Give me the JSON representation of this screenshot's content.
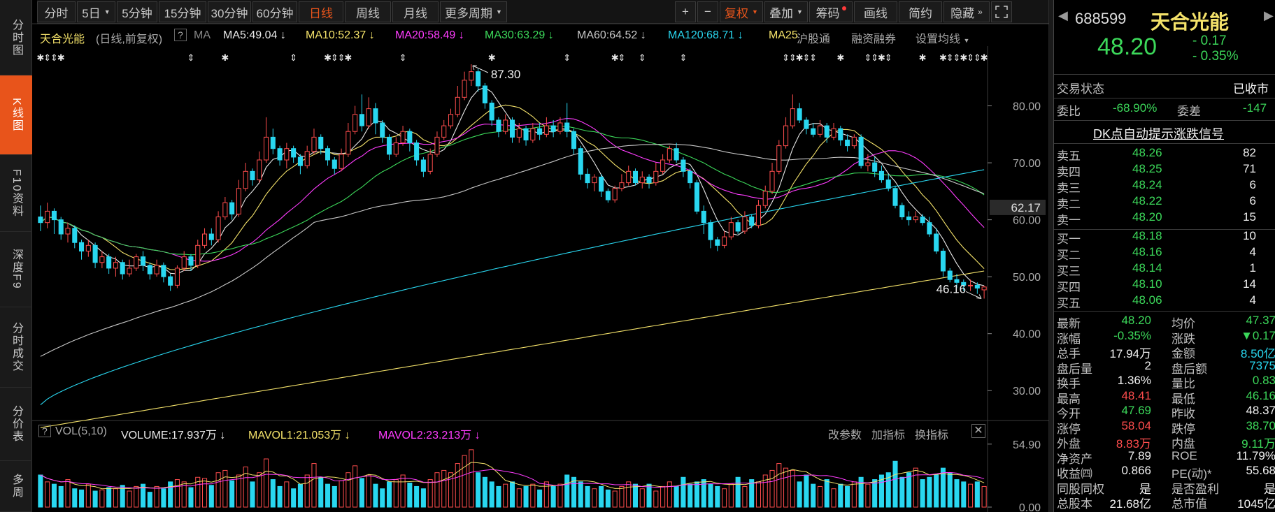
{
  "left_nav": [
    {
      "label": "分时图",
      "active": false
    },
    {
      "label": "K线图",
      "active": true
    },
    {
      "label": "F10资料",
      "active": false
    },
    {
      "label": "深度F9",
      "active": false
    },
    {
      "label": "分时成交",
      "active": false
    },
    {
      "label": "分价表",
      "active": false
    },
    {
      "label": "多周",
      "active": false
    }
  ],
  "toolbar": {
    "periods": [
      "分时",
      "5日",
      "5分钟",
      "15分钟",
      "30分钟",
      "60分钟",
      "日线",
      "周线",
      "月线",
      "更多周期"
    ],
    "active_period": "日线",
    "plus": "+",
    "minus": "−",
    "fuquan": "复权",
    "diejia": "叠加",
    "chouma": "筹码",
    "huaxian": "画线",
    "jianyue": "简约",
    "yincang": "隐藏",
    "fullscreen_icon": "expand-icon"
  },
  "ma_legend": {
    "stock": "天合光能",
    "mode": "(日线,前复权)",
    "help": "?",
    "ma": "MA",
    "ma5": "MA5:49.04",
    "ma10": "MA10:52.37",
    "ma20": "MA20:58.49",
    "ma30": "MA30:63.29",
    "ma60": "MA60:64.52",
    "ma120": "MA120:68.71",
    "ma250": "MA25",
    "hgt": "沪股通",
    "rzrq": "融资融券",
    "settings": "设置均线"
  },
  "colors": {
    "up": "#ff4d4d",
    "down": "#29d7f0",
    "ma5": "#e8e8e8",
    "ma10": "#f4e26a",
    "ma20": "#ff3cff",
    "ma30": "#3cd85a",
    "ma60": "#c8c8c8",
    "ma120": "#29d7f0",
    "ma250": "#f4e26a"
  },
  "volume_legend": {
    "help": "?",
    "vol": "VOL(5,10)",
    "volume": "VOLUME:17.937万",
    "mavol1": "MAVOL1:21.053万",
    "mavol2": "MAVOL2:23.213万",
    "gaicanshu": "改参数",
    "jiazhibiao": "加指标",
    "huanzhibiao": "换指标"
  },
  "chart_data": {
    "type": "candlestick",
    "title": "天合光能 (日线,前复权)",
    "price_axis": {
      "ticks": [
        "80.00",
        "70.00",
        "60.00",
        "50.00",
        "40.00",
        "30.00"
      ],
      "range": [
        25,
        90
      ]
    },
    "current_price_marker": "62.17",
    "high_label": "87.30",
    "low_label": "46.16",
    "volume_axis": {
      "ticks": [
        "54.90",
        "0.00"
      ],
      "range": [
        0,
        56
      ]
    },
    "candles": [
      [
        60.5,
        59.5,
        62.5,
        58.0
      ],
      [
        59.5,
        61.5,
        63.0,
        58.5
      ],
      [
        61.5,
        60.0,
        62.0,
        57.5
      ],
      [
        60.0,
        57.5,
        60.5,
        56.5
      ],
      [
        57.5,
        58.5,
        59.5,
        56.0
      ],
      [
        58.5,
        56.0,
        59.0,
        55.0
      ],
      [
        56.0,
        54.5,
        56.5,
        53.0
      ],
      [
        54.5,
        55.5,
        56.5,
        53.5
      ],
      [
        55.5,
        52.5,
        56.0,
        51.5
      ],
      [
        52.5,
        53.5,
        54.5,
        51.5
      ],
      [
        53.5,
        51.5,
        54.0,
        50.5
      ],
      [
        51.5,
        52.5,
        53.5,
        50.0
      ],
      [
        52.5,
        50.5,
        53.0,
        49.5
      ],
      [
        50.5,
        51.5,
        53.0,
        50.0
      ],
      [
        51.5,
        53.5,
        54.0,
        51.0
      ],
      [
        53.5,
        52.0,
        54.5,
        51.0
      ],
      [
        52.0,
        50.5,
        52.5,
        49.5
      ],
      [
        50.5,
        52.0,
        53.0,
        50.0
      ],
      [
        52.0,
        50.0,
        52.5,
        49.0
      ],
      [
        50.0,
        48.5,
        50.5,
        47.5
      ],
      [
        48.5,
        51.5,
        52.0,
        48.0
      ],
      [
        51.5,
        53.5,
        54.5,
        51.0
      ],
      [
        53.5,
        52.0,
        54.0,
        51.0
      ],
      [
        52.0,
        55.5,
        56.5,
        51.5
      ],
      [
        55.5,
        57.5,
        58.5,
        55.0
      ],
      [
        57.5,
        56.5,
        58.5,
        55.5
      ],
      [
        56.5,
        60.5,
        61.5,
        56.0
      ],
      [
        60.5,
        63.0,
        64.0,
        60.0
      ],
      [
        63.0,
        61.0,
        63.5,
        60.0
      ],
      [
        61.0,
        65.5,
        67.0,
        60.5
      ],
      [
        65.5,
        68.5,
        70.0,
        65.0
      ],
      [
        68.5,
        67.0,
        69.0,
        66.0
      ],
      [
        67.0,
        70.5,
        72.0,
        66.5
      ],
      [
        70.5,
        74.5,
        78.0,
        70.0
      ],
      [
        74.5,
        72.5,
        76.0,
        71.5
      ],
      [
        72.5,
        70.5,
        73.0,
        69.5
      ],
      [
        70.5,
        72.5,
        73.5,
        69.0
      ],
      [
        72.5,
        71.0,
        73.0,
        70.0
      ],
      [
        71.0,
        69.5,
        71.5,
        68.0
      ],
      [
        69.5,
        72.0,
        73.0,
        69.0
      ],
      [
        72.0,
        74.5,
        76.0,
        71.5
      ],
      [
        74.5,
        72.5,
        75.0,
        71.5
      ],
      [
        72.5,
        70.5,
        73.0,
        69.5
      ],
      [
        70.5,
        69.0,
        71.0,
        68.0
      ],
      [
        69.0,
        71.5,
        72.5,
        68.5
      ],
      [
        71.5,
        75.5,
        77.0,
        71.0
      ],
      [
        75.5,
        78.5,
        80.0,
        75.0
      ],
      [
        78.5,
        76.5,
        82.0,
        75.5
      ],
      [
        76.5,
        79.5,
        81.5,
        76.0
      ],
      [
        79.5,
        77.0,
        80.5,
        75.0
      ],
      [
        77.0,
        74.5,
        77.5,
        73.5
      ],
      [
        74.5,
        71.5,
        75.0,
        70.5
      ],
      [
        71.5,
        73.5,
        74.5,
        71.0
      ],
      [
        73.5,
        75.5,
        76.5,
        73.0
      ],
      [
        75.5,
        73.5,
        76.0,
        72.0
      ],
      [
        73.5,
        70.5,
        74.0,
        69.5
      ],
      [
        70.5,
        68.5,
        71.0,
        67.5
      ],
      [
        68.5,
        71.5,
        72.5,
        68.0
      ],
      [
        71.5,
        74.5,
        75.5,
        71.0
      ],
      [
        74.5,
        76.5,
        77.5,
        74.0
      ],
      [
        76.5,
        78.5,
        79.5,
        76.0
      ],
      [
        78.5,
        81.5,
        83.5,
        78.0
      ],
      [
        81.5,
        84.5,
        86.0,
        81.0
      ],
      [
        84.5,
        86.0,
        87.3,
        83.5
      ],
      [
        86.0,
        83.5,
        86.5,
        82.5
      ],
      [
        83.5,
        80.5,
        84.0,
        79.5
      ],
      [
        80.5,
        77.5,
        81.0,
        76.5
      ],
      [
        77.5,
        75.5,
        78.0,
        74.5
      ],
      [
        75.5,
        77.5,
        78.5,
        75.0
      ],
      [
        77.5,
        74.5,
        78.0,
        73.5
      ],
      [
        74.5,
        76.0,
        77.0,
        73.5
      ],
      [
        76.0,
        74.0,
        76.5,
        73.0
      ],
      [
        74.0,
        76.0,
        77.0,
        73.5
      ],
      [
        76.0,
        75.0,
        77.0,
        74.0
      ],
      [
        75.0,
        76.5,
        78.0,
        74.5
      ],
      [
        76.5,
        75.5,
        77.5,
        74.5
      ],
      [
        75.5,
        77.0,
        78.0,
        75.0
      ],
      [
        77.0,
        75.5,
        80.5,
        74.5
      ],
      [
        75.5,
        72.5,
        76.0,
        71.5
      ],
      [
        72.5,
        68.0,
        73.0,
        67.0
      ],
      [
        68.0,
        66.5,
        69.0,
        65.5
      ],
      [
        66.5,
        67.5,
        68.0,
        65.0
      ],
      [
        67.5,
        65.0,
        68.0,
        64.0
      ],
      [
        65.0,
        63.5,
        65.5,
        63.0
      ],
      [
        63.5,
        65.5,
        66.0,
        63.0
      ],
      [
        65.5,
        66.5,
        68.0,
        65.0
      ],
      [
        66.5,
        68.5,
        69.5,
        66.0
      ],
      [
        68.5,
        66.5,
        69.0,
        66.0
      ],
      [
        66.5,
        67.5,
        68.5,
        65.5
      ],
      [
        67.5,
        66.5,
        68.0,
        65.5
      ],
      [
        66.5,
        68.5,
        70.0,
        66.0
      ],
      [
        68.5,
        70.5,
        71.5,
        68.0
      ],
      [
        70.5,
        72.5,
        73.0,
        70.0
      ],
      [
        72.5,
        70.5,
        73.5,
        70.0
      ],
      [
        70.5,
        68.5,
        71.0,
        67.5
      ],
      [
        68.5,
        66.5,
        69.0,
        65.5
      ],
      [
        66.5,
        61.5,
        67.0,
        61.0
      ],
      [
        61.5,
        59.5,
        62.5,
        57.5
      ],
      [
        59.5,
        56.5,
        60.0,
        55.0
      ],
      [
        56.5,
        55.5,
        57.0,
        54.5
      ],
      [
        55.5,
        57.0,
        58.0,
        55.0
      ],
      [
        57.0,
        59.5,
        60.5,
        56.5
      ],
      [
        59.5,
        58.0,
        60.0,
        57.5
      ],
      [
        58.0,
        60.5,
        61.5,
        57.5
      ],
      [
        60.5,
        59.0,
        61.0,
        58.5
      ],
      [
        59.0,
        62.5,
        63.5,
        58.5
      ],
      [
        62.5,
        65.0,
        66.0,
        62.0
      ],
      [
        65.0,
        68.5,
        70.0,
        64.5
      ],
      [
        68.5,
        73.0,
        74.0,
        68.0
      ],
      [
        73.0,
        76.5,
        78.0,
        72.5
      ],
      [
        76.5,
        79.5,
        82.0,
        76.0
      ],
      [
        79.5,
        77.5,
        80.5,
        77.0
      ],
      [
        77.5,
        76.0,
        78.0,
        75.0
      ],
      [
        76.0,
        75.0,
        77.0,
        74.5
      ],
      [
        75.0,
        76.5,
        77.5,
        74.5
      ],
      [
        76.5,
        74.5,
        77.0,
        73.5
      ],
      [
        74.5,
        76.0,
        77.0,
        74.0
      ],
      [
        76.0,
        74.0,
        76.5,
        73.0
      ],
      [
        74.0,
        73.0,
        75.0,
        72.0
      ],
      [
        73.0,
        74.5,
        75.0,
        72.5
      ],
      [
        74.5,
        69.5,
        75.0,
        69.0
      ],
      [
        69.5,
        70.0,
        71.5,
        68.5
      ],
      [
        70.0,
        68.5,
        71.0,
        67.5
      ],
      [
        68.5,
        67.0,
        69.5,
        66.5
      ],
      [
        67.0,
        65.5,
        68.0,
        65.0
      ],
      [
        65.5,
        62.5,
        66.0,
        62.0
      ],
      [
        62.5,
        60.5,
        63.0,
        60.0
      ],
      [
        60.5,
        60.0,
        61.5,
        59.0
      ],
      [
        60.0,
        60.5,
        61.5,
        59.5
      ],
      [
        60.5,
        59.5,
        61.0,
        59.0
      ],
      [
        59.5,
        57.5,
        60.5,
        57.0
      ],
      [
        57.5,
        54.5,
        58.5,
        54.0
      ],
      [
        54.5,
        51.0,
        55.0,
        50.0
      ],
      [
        51.0,
        49.5,
        51.5,
        49.0
      ],
      [
        49.5,
        49.0,
        50.5,
        48.0
      ],
      [
        49.0,
        48.5,
        49.5,
        47.5
      ],
      [
        48.5,
        48.5,
        49.5,
        47.5
      ],
      [
        48.5,
        48.0,
        49.0,
        47.0
      ],
      [
        47.69,
        48.2,
        48.41,
        46.16
      ]
    ],
    "volumes": [
      28,
      22,
      20,
      18,
      24,
      16,
      15,
      20,
      14,
      15,
      17,
      16,
      19,
      14,
      18,
      20,
      13,
      18,
      16,
      22,
      24,
      22,
      17,
      26,
      25,
      19,
      30,
      32,
      23,
      28,
      35,
      22,
      30,
      42,
      24,
      18,
      22,
      16,
      20,
      28,
      38,
      26,
      20,
      18,
      23,
      30,
      36,
      25,
      28,
      20,
      16,
      22,
      24,
      28,
      21,
      18,
      16,
      24,
      30,
      32,
      30,
      38,
      45,
      50,
      30,
      26,
      22,
      18,
      20,
      22,
      16,
      18,
      20,
      15,
      22,
      18,
      20,
      28,
      26,
      22,
      18,
      16,
      18,
      15,
      14,
      18,
      22,
      20,
      16,
      20,
      14,
      18,
      22,
      18,
      26,
      20,
      22,
      24,
      20,
      18,
      16,
      20,
      26,
      18,
      24,
      22,
      28,
      32,
      38,
      34,
      32,
      22,
      28,
      20,
      18,
      24,
      16,
      20,
      18,
      22,
      26,
      20,
      24,
      28,
      30,
      40,
      26,
      30,
      34,
      24,
      26,
      28,
      34,
      30,
      24,
      22,
      20,
      22,
      18
    ],
    "ma_series": [
      {
        "name": "MA5",
        "color": "#e8e8e8"
      },
      {
        "name": "MA10",
        "color": "#f4e26a"
      },
      {
        "name": "MA20",
        "color": "#ff3cff"
      },
      {
        "name": "MA30",
        "color": "#3cd85a"
      },
      {
        "name": "MA60",
        "color": "#c8c8c8"
      },
      {
        "name": "MA120",
        "color": "#29d7f0"
      },
      {
        "name": "MA250",
        "color": "#f4e26a"
      }
    ]
  },
  "quote": {
    "code": "688599",
    "name": "天合光能",
    "price": "48.20",
    "change": "- 0.17",
    "change_pct": "- 0.35%",
    "status_label": "交易状态",
    "status_value": "已收市",
    "weibi_label": "委比",
    "weibi_value": "-68.90%",
    "weicha_label": "委差",
    "weicha_value": "-147",
    "dk_banner": "DK点自动提示涨跌信号"
  },
  "order_book": {
    "asks": [
      {
        "label": "卖五",
        "price": "48.26",
        "vol": "82"
      },
      {
        "label": "卖四",
        "price": "48.25",
        "vol": "71"
      },
      {
        "label": "卖三",
        "price": "48.24",
        "vol": "6"
      },
      {
        "label": "卖二",
        "price": "48.22",
        "vol": "6"
      },
      {
        "label": "卖一",
        "price": "48.20",
        "vol": "15"
      }
    ],
    "bids": [
      {
        "label": "买一",
        "price": "48.18",
        "vol": "10"
      },
      {
        "label": "买二",
        "price": "48.16",
        "vol": "4"
      },
      {
        "label": "买三",
        "price": "48.14",
        "vol": "1"
      },
      {
        "label": "买四",
        "price": "48.10",
        "vol": "14"
      },
      {
        "label": "买五",
        "price": "48.06",
        "vol": "4"
      }
    ]
  },
  "stats": [
    {
      "l1": "最新",
      "v1": "48.20",
      "c1": "green",
      "l2": "均价",
      "v2": "47.37",
      "c2": "green"
    },
    {
      "l1": "涨幅",
      "v1": "-0.35%",
      "c1": "green",
      "l2": "涨跌",
      "v2": "▼0.17",
      "c2": "green"
    },
    {
      "l1": "总手",
      "v1": "17.94万",
      "c1": "white",
      "l2": "金额",
      "v2": "8.50亿",
      "c2": "cyan"
    },
    {
      "l1": "盘后量",
      "v1": "2",
      "c1": "white",
      "l2": "盘后额",
      "v2": "7375",
      "c2": "cyan"
    },
    {
      "l1": "换手",
      "v1": "1.36%",
      "c1": "white",
      "l2": "量比",
      "v2": "0.83",
      "c2": "green"
    },
    {
      "l1": "最高",
      "v1": "48.41",
      "c1": "red",
      "l2": "最低",
      "v2": "46.16",
      "c2": "green"
    },
    {
      "l1": "今开",
      "v1": "47.69",
      "c1": "green",
      "l2": "昨收",
      "v2": "48.37",
      "c2": "white"
    },
    {
      "l1": "涨停",
      "v1": "58.04",
      "c1": "red",
      "l2": "跌停",
      "v2": "38.70",
      "c2": "green"
    },
    {
      "l1": "外盘",
      "v1": "8.83万",
      "c1": "red",
      "l2": "内盘",
      "v2": "9.11万",
      "c2": "green"
    },
    {
      "l1": "净资产",
      "v1": "7.89",
      "c1": "white",
      "l2": "ROE",
      "v2": "11.79%",
      "c2": "white"
    },
    {
      "l1": "收益㈣",
      "v1": "0.866",
      "c1": "white",
      "l2": "PE(动)*",
      "v2": "55.68",
      "c2": "white"
    },
    {
      "l1": "同股同权",
      "v1": "是",
      "c1": "white",
      "l2": "是否盈利",
      "v2": "是",
      "c2": "white"
    },
    {
      "l1": "总股本",
      "v1": "21.68亿",
      "c1": "white",
      "l2": "总市值",
      "v2": "1045亿",
      "c2": "white"
    }
  ]
}
